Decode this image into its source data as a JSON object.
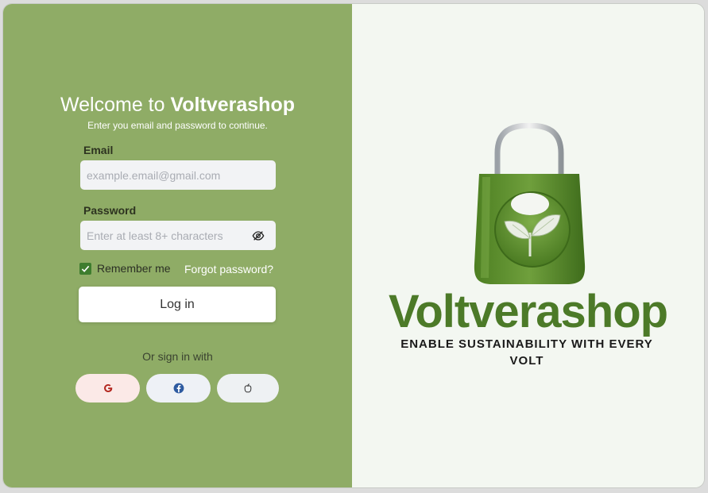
{
  "login": {
    "welcome_prefix": "Welcome to ",
    "welcome_brand": "Voltverashop",
    "subtitle": "Enter you email and password to continue.",
    "email_label": "Email",
    "email_placeholder": "example.email@gmail.com",
    "password_label": "Password",
    "password_placeholder": "Enter at least 8+ characters",
    "remember_label": "Remember me",
    "remember_checked": true,
    "forgot_label": "Forgot password?",
    "login_button": "Log in",
    "or_text": "Or sign in with",
    "social": [
      {
        "name": "google",
        "icon": "google-icon"
      },
      {
        "name": "facebook",
        "icon": "facebook-icon"
      },
      {
        "name": "apple",
        "icon": "apple-icon"
      }
    ]
  },
  "brand_panel": {
    "logo_icon": "shopping-bag-leaf-icon",
    "brand_name": "Voltverashop",
    "tagline": "ENABLE SUSTAINABILITY WITH EVERY VOLT"
  },
  "colors": {
    "left_panel": "#8fac66",
    "right_panel": "#f3f7f1",
    "brand_green": "#4c7a28",
    "checkbox": "#3e7d2e"
  }
}
